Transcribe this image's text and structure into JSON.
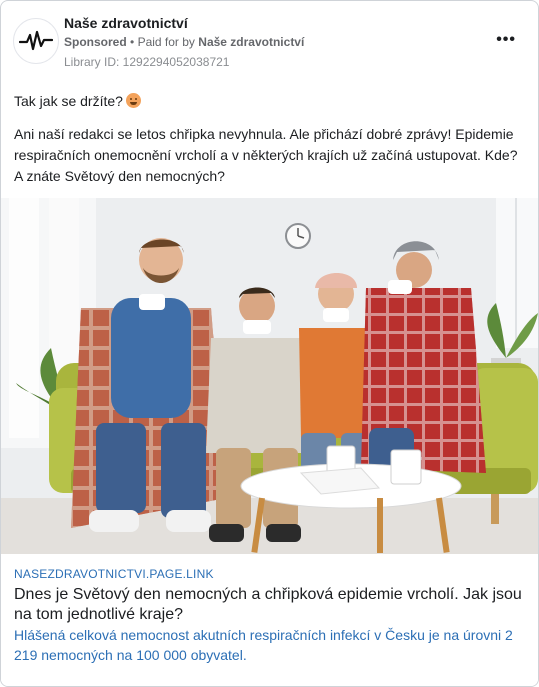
{
  "header": {
    "page_name": "Naše zdravotnictví",
    "sponsored_label": "Sponsored",
    "separator": "•",
    "paid_for_prefix": "Paid for by",
    "paid_for_name": "Naše zdravotnictví",
    "library_id": "Library ID: 1292294052038721",
    "more_icon": "more-options-icon",
    "more_label": "•••",
    "avatar_icon": "heartbeat-line-icon"
  },
  "post": {
    "greeting": "Tak jak se držíte?",
    "greeting_emoji": "sick-face-emoji",
    "body": "Ani naší redakci se letos chřipka nevyhnula. Ale přichází dobré zprávy! Epidemie respiračních onemocnění vrcholí a v některých krajích už začíná ustupovat. Kde? A znáte Světový den nemocných?"
  },
  "image": {
    "kind": "photo-sick-family-on-couch"
  },
  "link_preview": {
    "domain": "NASEZDRAVOTNICTVI.PAGE.LINK",
    "title": "Dnes je Světový den nemocných a chřipková epidemie vrcholí. Jak jsou na tom jednotlivé kraje?",
    "description": "Hlášená celková nemocnost akutních respiračních infekcí v Česku je na úrovni 2 219 nemocných na 100 000 obyvatel."
  },
  "colors": {
    "link_blue": "#2c6fb5",
    "text": "#1c1e21",
    "muted": "#65676b"
  }
}
